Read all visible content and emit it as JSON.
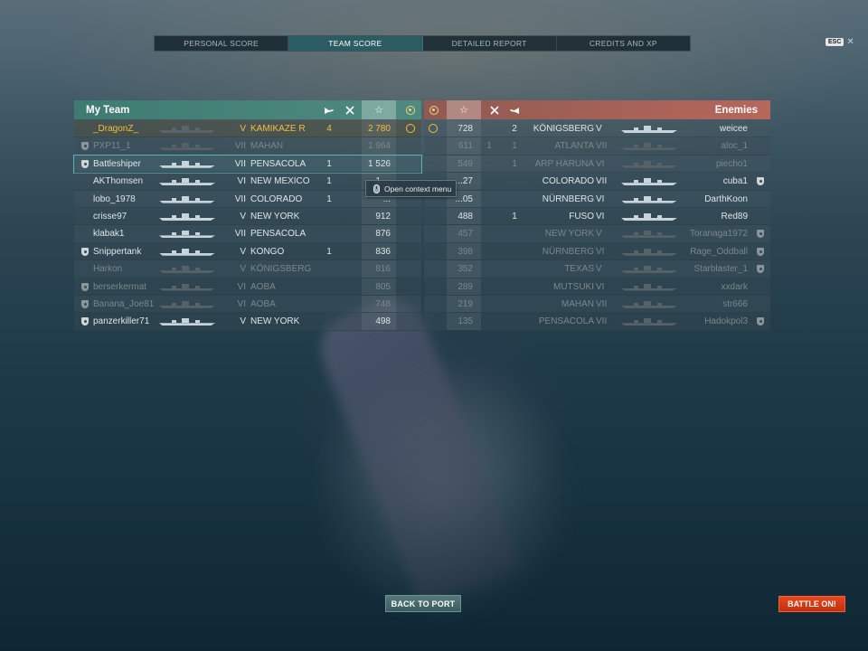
{
  "tabs": [
    {
      "label": "PERSONAL SCORE",
      "active": false
    },
    {
      "label": "TEAM SCORE",
      "active": true
    },
    {
      "label": "DETAILED REPORT",
      "active": false
    },
    {
      "label": "CREDITS AND XP",
      "active": false
    }
  ],
  "esc": {
    "key": "ESC",
    "close": "✕"
  },
  "my_team": {
    "title": "My Team",
    "rows": [
      {
        "name": "_DragonZ_",
        "tier": "V",
        "ship": "KAMIKAZE R",
        "planes": "4",
        "ships": "",
        "score": "2 780",
        "state": "player",
        "badge": false
      },
      {
        "name": "PXP11_1",
        "tier": "VII",
        "ship": "MAHAN",
        "planes": "",
        "ships": "",
        "score": "1 964",
        "state": "dead",
        "badge": true
      },
      {
        "name": "Battleshiper",
        "tier": "VII",
        "ship": "PENSACOLA",
        "planes": "1",
        "ships": "",
        "score": "1 526",
        "state": "selected",
        "badge": true
      },
      {
        "name": "AKThomsen",
        "tier": "VI",
        "ship": "NEW MEXICO",
        "planes": "1",
        "ships": "",
        "score": "1 ...",
        "state": "alive",
        "badge": false
      },
      {
        "name": "lobo_1978",
        "tier": "VII",
        "ship": "COLORADO",
        "planes": "1",
        "ships": "",
        "score": "...",
        "state": "alive",
        "badge": false
      },
      {
        "name": "crisse97",
        "tier": "V",
        "ship": "NEW YORK",
        "planes": "",
        "ships": "",
        "score": "912",
        "state": "alive",
        "badge": false
      },
      {
        "name": "klabak1",
        "tier": "VII",
        "ship": "PENSACOLA",
        "planes": "",
        "ships": "",
        "score": "876",
        "state": "alive",
        "badge": false
      },
      {
        "name": "Snippertank",
        "tier": "V",
        "ship": "KONGO",
        "planes": "1",
        "ships": "",
        "score": "836",
        "state": "alive",
        "badge": true
      },
      {
        "name": "Harkon",
        "tier": "V",
        "ship": "KÖNIGSBERG",
        "planes": "",
        "ships": "",
        "score": "816",
        "state": "dead",
        "badge": false
      },
      {
        "name": "berserkermat",
        "tier": "VI",
        "ship": "AOBA",
        "planes": "",
        "ships": "",
        "score": "805",
        "state": "dead",
        "badge": true
      },
      {
        "name": "Banana_Joe81",
        "tier": "VI",
        "ship": "AOBA",
        "planes": "",
        "ships": "",
        "score": "748",
        "state": "dead",
        "badge": true
      },
      {
        "name": "panzerkiller71",
        "tier": "V",
        "ship": "NEW YORK",
        "planes": "",
        "ships": "",
        "score": "498",
        "state": "alive",
        "badge": true
      }
    ]
  },
  "enemies": {
    "title": "Enemies",
    "rows": [
      {
        "name": "weicee",
        "tier": "V",
        "ship": "KÖNIGSBERG",
        "planes": "2",
        "ships": "",
        "score": "728",
        "state": "alive",
        "badge": false
      },
      {
        "name": "aloc_1",
        "tier": "VII",
        "ship": "ATLANTA",
        "planes": "1",
        "ships": "1",
        "score": "611",
        "state": "dead",
        "badge": false
      },
      {
        "name": "piecho1",
        "tier": "VI",
        "ship": "ARP HARUNA",
        "planes": "1",
        "ships": "",
        "score": "549",
        "state": "dead",
        "badge": false
      },
      {
        "name": "cuba1",
        "tier": "VII",
        "ship": "COLORADO",
        "planes": "",
        "ships": "",
        "score": "...27",
        "state": "alive",
        "badge": true
      },
      {
        "name": "DarthKoon",
        "tier": "VI",
        "ship": "NÜRNBERG",
        "planes": "",
        "ships": "",
        "score": "...05",
        "state": "alive",
        "badge": false
      },
      {
        "name": "Red89",
        "tier": "VI",
        "ship": "FUSO",
        "planes": "1",
        "ships": "",
        "score": "488",
        "state": "alive",
        "badge": false
      },
      {
        "name": "Toranaga1972",
        "tier": "V",
        "ship": "NEW YORK",
        "planes": "",
        "ships": "",
        "score": "457",
        "state": "dead",
        "badge": true
      },
      {
        "name": "Rage_Oddball",
        "tier": "VI",
        "ship": "NÜRNBERG",
        "planes": "",
        "ships": "",
        "score": "398",
        "state": "dead",
        "badge": true
      },
      {
        "name": "Starblaster_1",
        "tier": "V",
        "ship": "TEXAS",
        "planes": "",
        "ships": "",
        "score": "352",
        "state": "dead",
        "badge": true
      },
      {
        "name": "xxdark",
        "tier": "VI",
        "ship": "MUTSUKI",
        "planes": "",
        "ships": "",
        "score": "289",
        "state": "dead",
        "badge": false
      },
      {
        "name": "str666",
        "tier": "VII",
        "ship": "MAHAN",
        "planes": "",
        "ships": "",
        "score": "219",
        "state": "dead",
        "badge": false
      },
      {
        "name": "Hadokpol3",
        "tier": "VII",
        "ship": "PENSACOLA",
        "planes": "",
        "ships": "",
        "score": "135",
        "state": "dead",
        "badge": true
      }
    ]
  },
  "context_menu": {
    "label": "Open context menu"
  },
  "buttons": {
    "back_to_port": "BACK TO PORT",
    "battle_on": "BATTLE ON!"
  },
  "icons": {
    "planes": "plane-icon",
    "ships": "ship-kill-icon",
    "score": "star-icon",
    "achievement": "emblem-icon"
  },
  "colors": {
    "my_team": "#4e8a7f",
    "enemies": "#b7675b",
    "player": "#f0c040",
    "battle_button": "#e8441c"
  }
}
